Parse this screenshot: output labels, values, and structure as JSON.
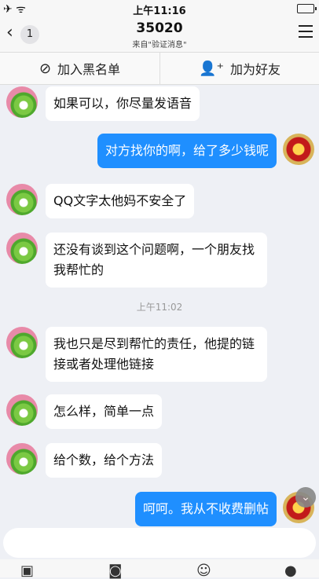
{
  "status_bar": {
    "left_icons": "✈ ᯤ",
    "time": "上午11:16"
  },
  "header": {
    "back_icon": "chevron-left-icon",
    "back_badge": "1",
    "title": "35020",
    "subtitle": "来自\"验证消息\"",
    "menu_icon": "hamburger-icon"
  },
  "actions": {
    "block_label": "加入黑名单",
    "add_friend_label": "加为好友"
  },
  "messages": [
    {
      "side": "left",
      "text": "如果可以，你尽量发语音"
    },
    {
      "side": "right",
      "text": "对方找你的啊，给了多少钱呢"
    },
    {
      "side": "left",
      "text": "QQ文字太他妈不安全了"
    },
    {
      "side": "left",
      "text": "还没有谈到这个问题啊，一个朋友找我帮忙的"
    },
    {
      "timestamp": "上午11:02"
    },
    {
      "side": "left",
      "text": "我也只是尽到帮忙的责任，他提的链接或者处理他链接"
    },
    {
      "side": "left",
      "text": "怎么样，简单一点"
    },
    {
      "side": "left",
      "text": "给个数，给个方法"
    },
    {
      "side": "right",
      "text": "呵呵。我从不收费删帖"
    }
  ],
  "colors": {
    "outgoing_bubble": "#1f8fff",
    "incoming_bubble": "#ffffff",
    "background": "#eef0f5"
  }
}
